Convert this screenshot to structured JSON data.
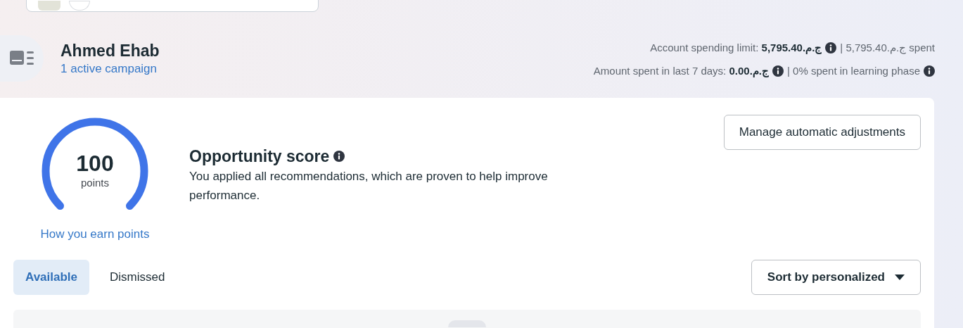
{
  "account": {
    "name": "Ahmed Ehab",
    "campaigns_link": "1 active campaign"
  },
  "spending": [
    {
      "label": "Account spending limit: **ج.م.5,795.40**",
      "suffix": "| ج.م.5,795.40 spent",
      "suffix_info": false
    },
    {
      "label": "Amount spent in last 7 days: **ج.م.0.00**",
      "suffix": "| 0% spent in learning phase",
      "suffix_info": true
    }
  ],
  "score": {
    "value": "100",
    "unit": "points",
    "link": "How you earn points",
    "title": "Opportunity score",
    "description": "You applied all recommendations, which are proven to help improve performance."
  },
  "manage_button": "Manage automatic adjustments",
  "tabs": [
    {
      "label": "Available",
      "selected": true
    },
    {
      "label": "Dismissed",
      "selected": false
    }
  ],
  "sort": {
    "label": "Sort by personalized"
  }
}
